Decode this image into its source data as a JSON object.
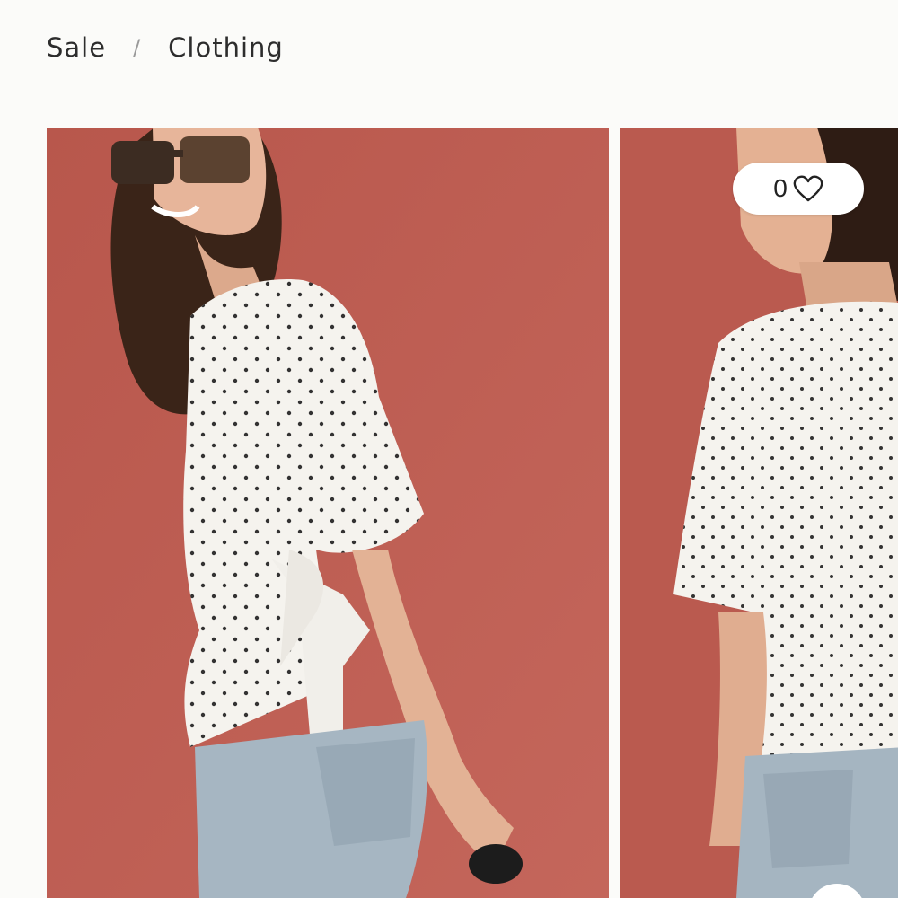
{
  "breadcrumb": {
    "items": [
      {
        "label": "Sale"
      },
      {
        "label": "Clothing"
      }
    ],
    "separator": "/"
  },
  "gallery": {
    "background_color": "#bd5b50",
    "slides": [
      {
        "subject": "model-polka-dot-wrap-top-side-view"
      },
      {
        "subject": "model-polka-dot-wrap-top-back-view"
      }
    ]
  },
  "wishlist": {
    "count": "0",
    "icon": "heart-icon"
  }
}
